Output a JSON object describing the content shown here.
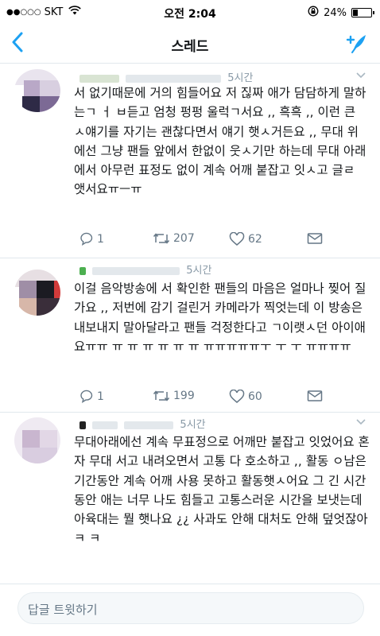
{
  "status": {
    "carrier": "SKT",
    "signal_dots": "●●○○○",
    "time": "오전 2:04",
    "battery_percent": "24%",
    "battery_level": 0.24
  },
  "nav": {
    "back_icon": "chevron-left-icon",
    "title": "스레드",
    "compose_icon": "compose-tweet-icon"
  },
  "tweets": [
    {
      "time": "5시간",
      "text": "서 없기때문에 거의 힘들어요 저 짆짜 애가 담담하게 말하는ㄱ ㅓ ㅂ듣고 엄청 펑펑 울럭ㄱ서요 ,, 흑흑 ,, 이런 큰 ㅅ얘기를 자기는 괜찮다면서 얘기 햇ㅅ거든요 ,, 무대 위에선 그냥 팬들 앞에서 한없이 웃ㅅ기만 하는데 무대 아래에서 아무런 표정도 없이 계속 어깨 붙잡고 잇ㅅ고 글ㄹ 앳서요ㅠㅡㅠ",
      "replies": "1",
      "retweets": "207",
      "likes": "62"
    },
    {
      "time": "5시간",
      "text": "이걸 음악방송에 서 확인한 팬들의 마음은 얼마나 찢어 질가요 ,, 저번에 감기 걸린거 카메라가 찍엇는데 이 방송은 내보내지 말아달라고 팬들 걱정한다고 ㄱ이랫ㅅ던 아이애요ㅠㅠ ㅠ ㅠ ㅠ ㅠ ㅠ ㅠ ㅠㅠㅠㅠㅠㅜ ㅜ ㅜ  ㅠㅠㅠㅠ",
      "replies": "1",
      "retweets": "199",
      "likes": "60"
    },
    {
      "time": "5시간",
      "text": "무대아래에선 계속 무표정으로 어깨만 붙잡고 잇었어요 혼자 무대 서고 내려오면서 고통 다 호소하고 ,, 활동 ㅇ남은 기간동안 계속 어깨 사용 못하고 활동햇ㅅ어요 그 긴 시간동안 애는 너무 나도 힘들고 고통스러운 시간을 보냇는데 아육대는 뭘 햇나요 ¿¿ 사과도 안해 대처도 안해 덮엇잖아ㅋ ㅋ"
    }
  ],
  "reply_bar": {
    "placeholder": "답글 트윗하기"
  },
  "colors": {
    "accent": "#1da1f2",
    "text": "#14171a",
    "muted": "#657786",
    "divider": "#e1e8ed"
  }
}
